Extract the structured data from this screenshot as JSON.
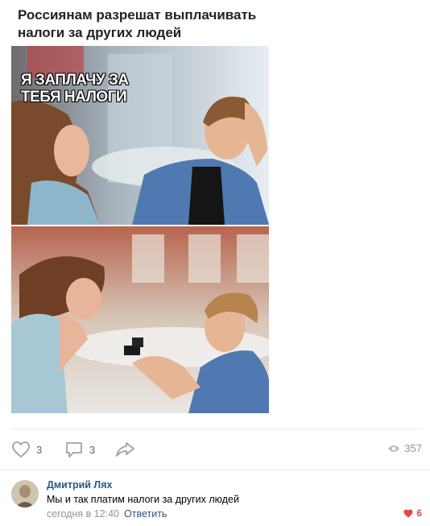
{
  "post": {
    "title": "Россиянам разрешат выплачивать налоги за других людей",
    "meme_caption": "Я ЗАПЛАЧУ ЗА\nТЕБЯ НАЛОГИ"
  },
  "actions": {
    "likes": "3",
    "comments": "3",
    "views": "357"
  },
  "comment": {
    "author": "Дмитрий Лях",
    "text": "Мы и так платим налоги за других людей",
    "time": "сегодня в 12:40",
    "reply_label": "Ответить",
    "likes": "6"
  },
  "colors": {
    "link": "#2a5885",
    "like_red": "#e64646",
    "icon_blue": "#99a2ad"
  },
  "icons": {
    "like": "heart-outline-icon",
    "comment": "speech-bubble-icon",
    "share": "share-arrow-icon",
    "views": "eye-icon",
    "comment_like": "heart-filled-icon"
  }
}
